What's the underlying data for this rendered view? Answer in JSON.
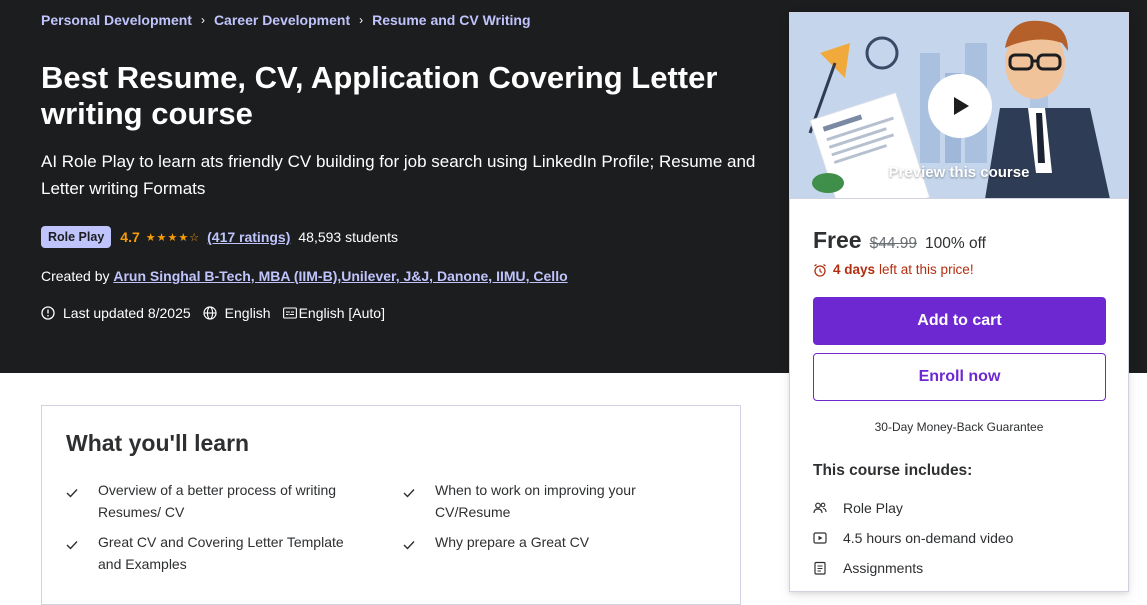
{
  "breadcrumb": [
    "Personal Development",
    "Career Development",
    "Resume and CV Writing"
  ],
  "course": {
    "title": "Best Resume, CV, Application Covering Letter writing course",
    "subtitle": "AI Role Play to learn ats friendly CV building for job search using LinkedIn Profile; Resume and Letter writing Formats",
    "badge": "Role Play",
    "rating": "4.7",
    "stars": 4.7,
    "ratings_count": "(417 ratings)",
    "students": "48,593 students",
    "created_by_label": "Created by",
    "instructors": "Arun Singhal B-Tech, MBA (IIM-B),Unilever, J&J, Danone, IIMU, Cello",
    "last_updated": "Last updated 8/2025",
    "language": "English",
    "captions": "English [Auto]"
  },
  "sidebar": {
    "preview_label": "Preview this course",
    "price": "Free",
    "original_price": "$44.99",
    "discount": "100% off",
    "timer_days": "4 days",
    "timer_rest": "left at this price!",
    "add_to_cart": "Add to cart",
    "enroll_now": "Enroll now",
    "guarantee": "30-Day Money-Back Guarantee",
    "includes_title": "This course includes:",
    "includes": [
      {
        "icon": "role-play-icon",
        "label": "Role Play"
      },
      {
        "icon": "video-icon",
        "label": "4.5 hours on-demand video"
      },
      {
        "icon": "assignment-icon",
        "label": "Assignments"
      }
    ]
  },
  "learn": {
    "title": "What you'll learn",
    "items": [
      "Overview of a better process of writing Resumes/ CV",
      "When to work on improving your CV/Resume",
      "Great CV and Covering Letter Template and Examples",
      "Why prepare a Great CV"
    ]
  },
  "colors": {
    "hero_bg": "#1c1d1f",
    "accent_purple": "#6d28d2",
    "link_lavender": "#c0c4fc",
    "star_orange": "#f69c08",
    "timer_red": "#b32d0f"
  }
}
